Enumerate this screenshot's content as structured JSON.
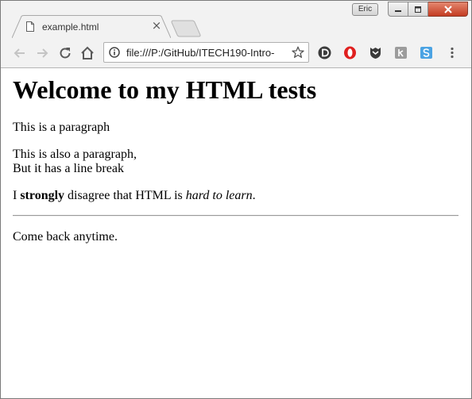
{
  "window": {
    "profile_name": "Eric"
  },
  "tab": {
    "title": "example.html"
  },
  "toolbar": {
    "url": "file:///P:/GitHub/ITECH190-Intro-"
  },
  "page": {
    "heading": "Welcome to my HTML tests",
    "paragraph1": "This is a paragraph",
    "paragraph2_line1": "This is also a paragraph,",
    "paragraph2_line2": "But it has a line break",
    "paragraph3_start": "I ",
    "paragraph3_bold": "strongly",
    "paragraph3_middle": " disagree that HTML is ",
    "paragraph3_italic": "hard to learn",
    "paragraph3_end": ".",
    "closing": "Come back anytime."
  },
  "icons": {
    "tab_favicon": "page-icon",
    "tab_close": "close-icon",
    "back": "arrow-left-icon",
    "forward": "arrow-right-icon",
    "reload": "reload-icon",
    "home": "home-icon",
    "site_info": "info-icon",
    "bookmark": "star-icon",
    "extensions": [
      "disconnect-icon",
      "opera-icon",
      "shield-icon",
      "grey-extension-icon",
      "skype-icon"
    ],
    "menu": "kebab-menu-icon"
  },
  "colors": {
    "chrome_frame": "#f2f2f2",
    "close_button": "#c8452c",
    "skype_blue": "#4ba3e3",
    "opera_red": "#e0201f"
  }
}
